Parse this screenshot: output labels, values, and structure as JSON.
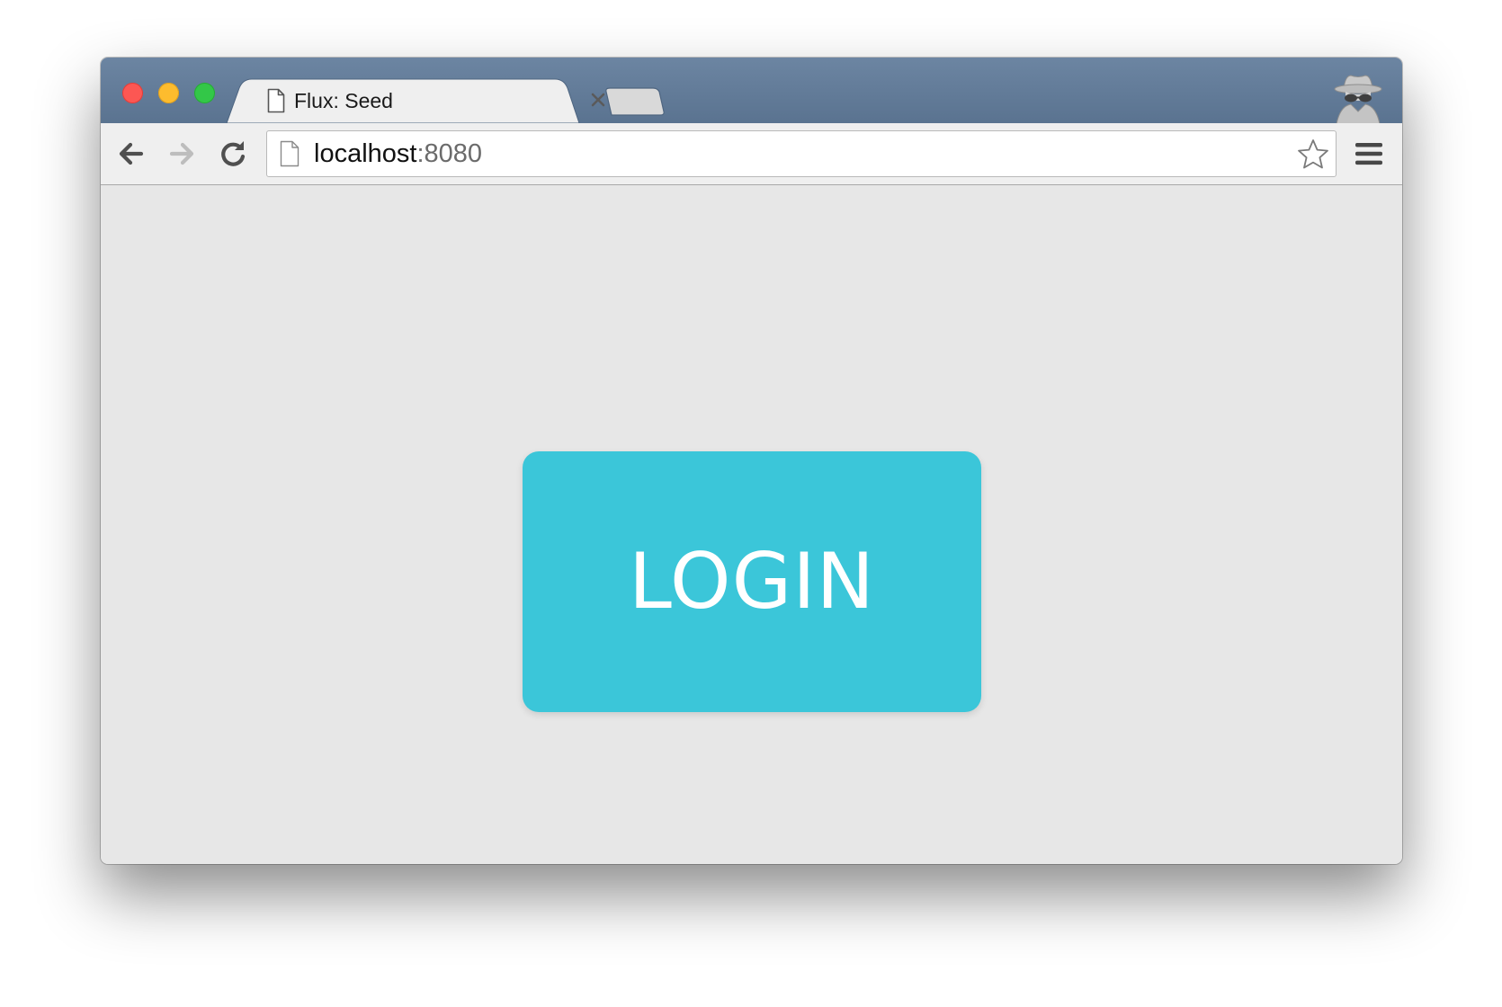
{
  "browser": {
    "tab": {
      "title": "Flux: Seed",
      "favicon": "page-icon",
      "close_icon": "close-icon"
    },
    "new_tab_icon": "new-tab-icon",
    "profile_icon": "incognito-icon",
    "toolbar": {
      "back_icon": "arrow-left-icon",
      "forward_icon": "arrow-right-icon",
      "reload_icon": "reload-icon",
      "menu_icon": "hamburger-menu-icon"
    },
    "address_bar": {
      "host": "localhost",
      "port": ":8080",
      "page_icon": "page-icon",
      "bookmark_icon": "star-icon"
    }
  },
  "page": {
    "login_button_label": "LOGIN"
  },
  "colors": {
    "login_button": "#3bc6d9",
    "login_text": "#ffffff",
    "page_background": "#e7e7e7",
    "tabstrip": "#62799a",
    "traffic_close": "#fc5753",
    "traffic_minimize": "#fdbc2e",
    "traffic_maximize": "#33c748"
  }
}
